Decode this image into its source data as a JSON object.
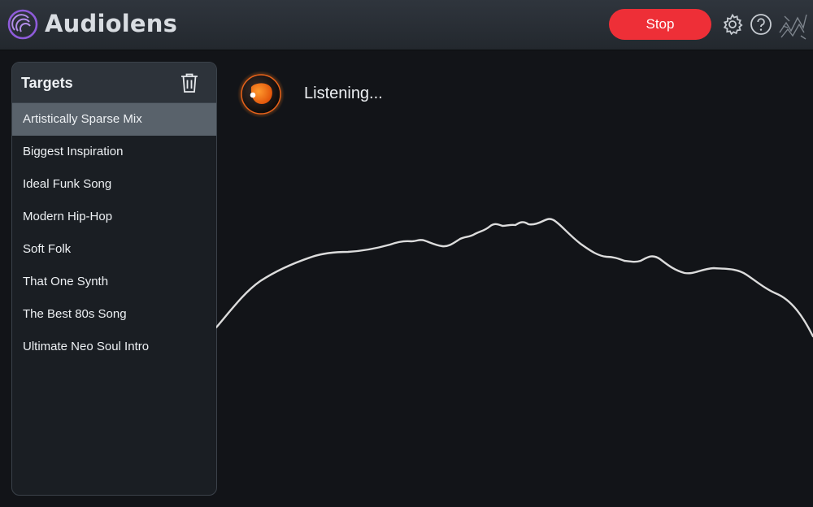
{
  "header": {
    "app_title": "Audiolens",
    "stop_label": "Stop",
    "icons": [
      "logo-icon",
      "gear-icon",
      "help-icon",
      "brand-icon"
    ],
    "colors": {
      "stop_button": "#ee2f37",
      "logo_accent": "#8e5bd9"
    }
  },
  "sidebar": {
    "title": "Targets",
    "selected_index": 0,
    "items": [
      {
        "label": "Artistically Sparse Mix"
      },
      {
        "label": "Biggest Inspiration"
      },
      {
        "label": "Ideal Funk Song"
      },
      {
        "label": "Modern Hip-Hop"
      },
      {
        "label": "Soft Folk"
      },
      {
        "label": "That One Synth"
      },
      {
        "label": "The Best 80s Song"
      },
      {
        "label": "Ultimate Neo Soul Intro"
      }
    ]
  },
  "main": {
    "status_text": "Listening...",
    "status_icon": "listening-orb-icon",
    "colors": {
      "orb": "#f36b16",
      "spectrum_line": "#dcdcdc"
    }
  }
}
